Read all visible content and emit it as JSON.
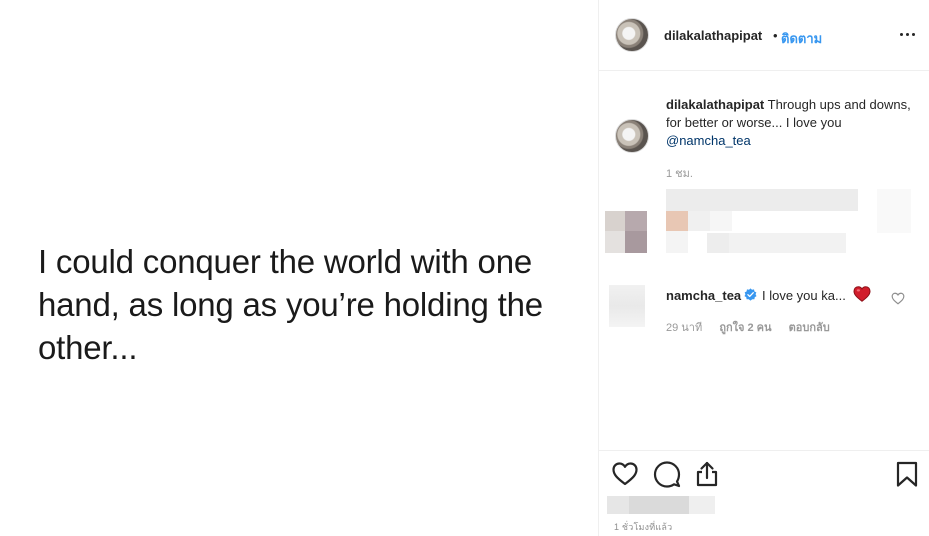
{
  "post": {
    "quote_text": "I could conquer the world with one\nhand, as long as you’re holding the\nother..."
  },
  "header": {
    "username": "dilakalathapipat",
    "separator": "•",
    "follow_label": "ติดตาม",
    "more_icon": "more-horizontal-icon"
  },
  "caption": {
    "username": "dilakalathapipat",
    "text": "Through ups and downs, for better or worse... I love you",
    "mention": "@namcha_tea",
    "time": "1 ชม."
  },
  "comments": [
    {
      "username": "namcha_tea",
      "verified": true,
      "text": "I love you ka...",
      "emoji": "red-heart",
      "time": "29 นาที",
      "likes": "ถูกใจ 2 คน",
      "reply_label": "ตอบกลับ"
    }
  ],
  "actions": {
    "like_icon": "heart-outline-icon",
    "comment_icon": "comment-bubble-icon",
    "share_icon": "share-icon",
    "save_icon": "bookmark-icon"
  },
  "post_time": "1 ชั่วโมงที่แล้ว",
  "colors": {
    "link_blue": "#3897f0",
    "mention_blue": "#003569",
    "heart_red": "#ed4956",
    "verified_blue": "#3897f0",
    "muted_gray": "#999999",
    "border": "#efefef"
  }
}
